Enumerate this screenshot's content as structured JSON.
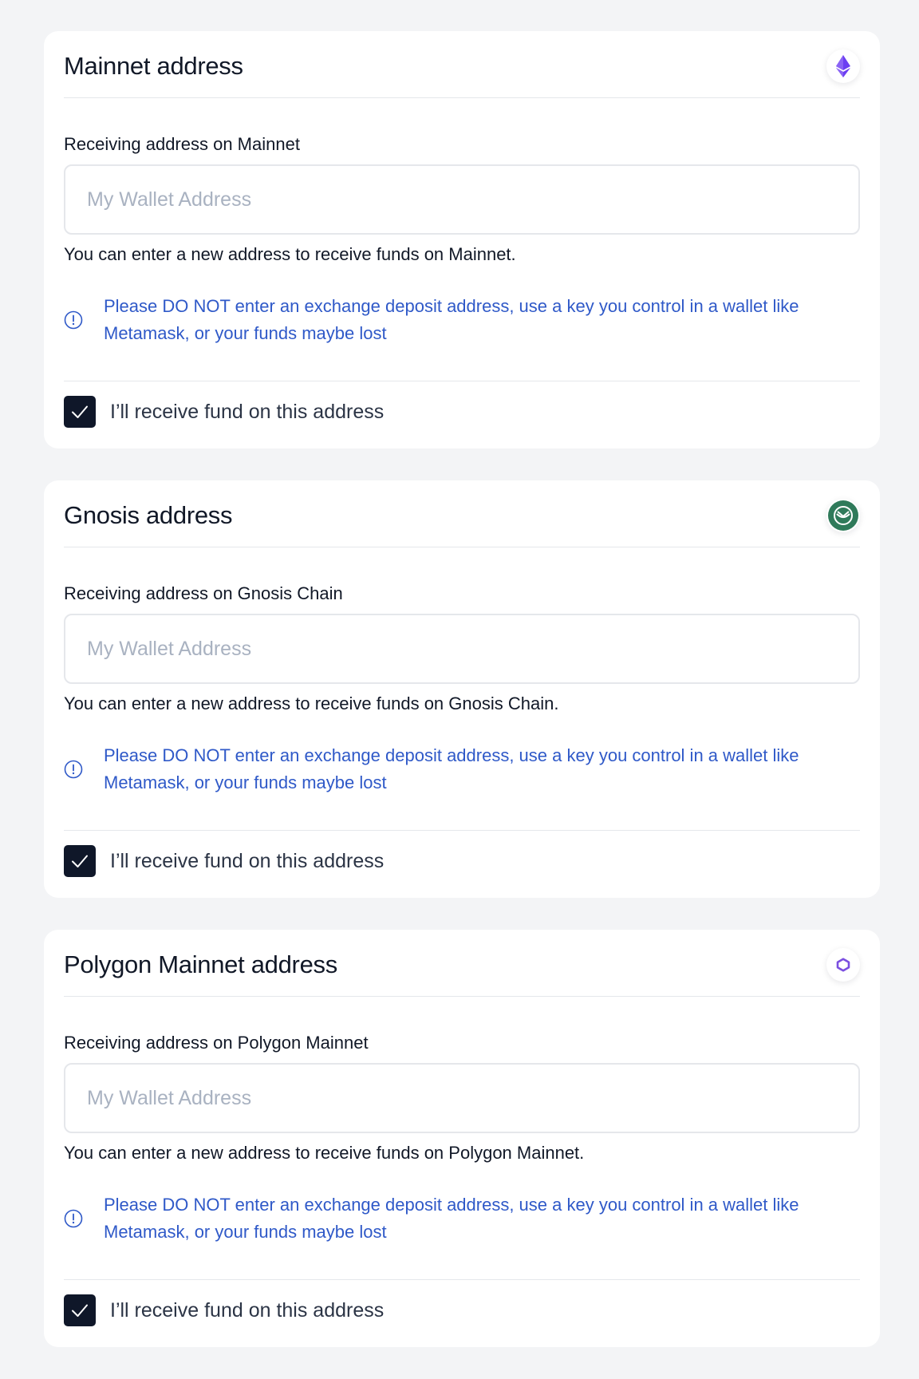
{
  "colors": {
    "page_background": "#f3f4f6",
    "card_background": "#ffffff",
    "warning_text": "#2f59c8",
    "checkbox_fill": "#0f1729",
    "placeholder": "#a9b2c1",
    "ethereum_icon": "#6c3ef2",
    "gnosis_icon": "#2f7a5a",
    "polygon_icon": "#7b4fe0"
  },
  "sections": [
    {
      "title": "Mainnet address",
      "icon": "ethereum-icon",
      "field_label": "Receiving address on Mainnet",
      "input_value": "",
      "input_placeholder": "My Wallet Address",
      "helper_text": "You can enter a new address to receive funds on Mainnet.",
      "warning_text": "Please DO NOT enter an exchange deposit address, use a key you control in a wallet like Metamask, or your funds maybe lost",
      "confirm_label": "I’ll receive fund on this address",
      "confirm_checked": true
    },
    {
      "title": "Gnosis address",
      "icon": "gnosis-icon",
      "field_label": "Receiving address on Gnosis Chain",
      "input_value": "",
      "input_placeholder": "My Wallet Address",
      "helper_text": "You can enter a new address to receive funds on Gnosis Chain.",
      "warning_text": "Please DO NOT enter an exchange deposit address, use a key you control in a wallet like Metamask, or your funds maybe lost",
      "confirm_label": "I’ll receive fund on this address",
      "confirm_checked": true
    },
    {
      "title": "Polygon Mainnet address",
      "icon": "polygon-icon",
      "field_label": "Receiving address on Polygon Mainnet",
      "input_value": "",
      "input_placeholder": "My Wallet Address",
      "helper_text": "You can enter a new address to receive funds on Polygon Mainnet.",
      "warning_text": "Please DO NOT enter an exchange deposit address, use a key you control in a wallet like Metamask, or your funds maybe lost",
      "confirm_label": "I’ll receive fund on this address",
      "confirm_checked": true
    }
  ]
}
